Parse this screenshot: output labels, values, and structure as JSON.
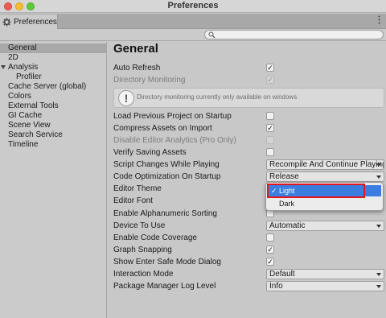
{
  "window": {
    "title": "Preferences"
  },
  "tab": {
    "label": "Preferences"
  },
  "search": {
    "placeholder": ""
  },
  "sidebar": {
    "items": [
      {
        "label": "General",
        "selected": true
      },
      {
        "label": "2D"
      },
      {
        "label": "Analysis",
        "expanded": true
      },
      {
        "label": "Profiler"
      },
      {
        "label": "Cache Server (global)"
      },
      {
        "label": "Colors"
      },
      {
        "label": "External Tools"
      },
      {
        "label": "GI Cache"
      },
      {
        "label": "Scene View"
      },
      {
        "label": "Search Service"
      },
      {
        "label": "Timeline"
      }
    ]
  },
  "main": {
    "title": "General",
    "info_message": "Directory monitoring currently only available on windows",
    "rows": {
      "auto_refresh": {
        "label": "Auto Refresh",
        "checked": true
      },
      "directory_monitoring": {
        "label": "Directory Monitoring",
        "checked": true,
        "disabled": true
      },
      "load_previous_project": {
        "label": "Load Previous Project on Startup",
        "checked": false
      },
      "compress_assets": {
        "label": "Compress Assets on Import",
        "checked": true
      },
      "disable_editor_analytics": {
        "label": "Disable Editor Analytics (Pro Only)",
        "checked": false,
        "disabled": true
      },
      "verify_saving_assets": {
        "label": "Verify Saving Assets",
        "checked": false
      },
      "script_changes": {
        "label": "Script Changes While Playing",
        "value": "Recompile And Continue Playing"
      },
      "code_optimization": {
        "label": "Code Optimization On Startup",
        "value": "Release"
      },
      "editor_theme": {
        "label": "Editor Theme",
        "value": "Light"
      },
      "editor_font": {
        "label": "Editor Font"
      },
      "alphanumeric_sorting": {
        "label": "Enable Alphanumeric Sorting",
        "checked": false
      },
      "device_to_use": {
        "label": "Device To Use",
        "value": "Automatic"
      },
      "code_coverage": {
        "label": "Enable Code Coverage",
        "checked": false
      },
      "graph_snapping": {
        "label": "Graph Snapping",
        "checked": true
      },
      "safe_mode_dialog": {
        "label": "Show Enter Safe Mode Dialog",
        "checked": true
      },
      "interaction_mode": {
        "label": "Interaction Mode",
        "value": "Default"
      },
      "package_manager_log": {
        "label": "Package Manager Log Level",
        "value": "Info"
      }
    }
  },
  "theme_menu": {
    "options": [
      {
        "label": "Light",
        "selected": true
      },
      {
        "label": "Dark",
        "selected": false
      }
    ],
    "check_glyph": "✓"
  },
  "colors": {
    "highlight": "#3a7ee0",
    "annotation": "#e8141c"
  },
  "glyphs": {
    "check": "✓"
  }
}
